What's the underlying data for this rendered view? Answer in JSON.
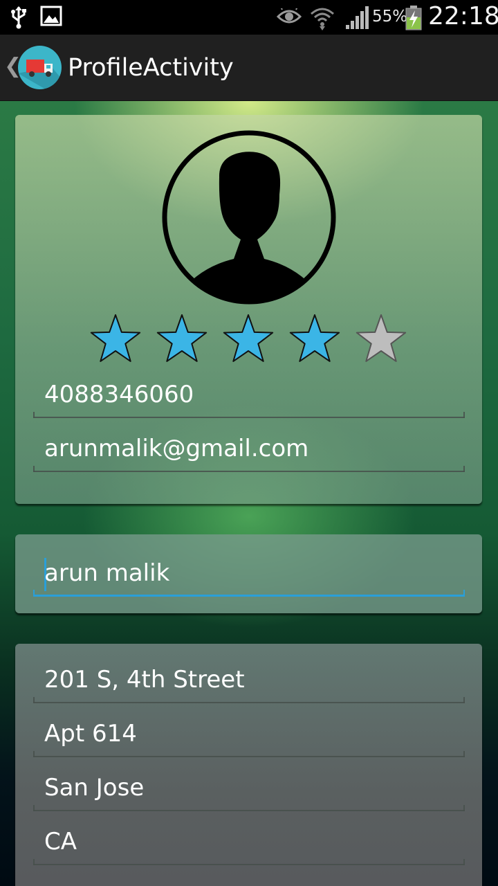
{
  "status_bar": {
    "battery_percent": "55%",
    "clock": "22:18",
    "icons": [
      "usb-icon",
      "gallery-icon",
      "eye-icon",
      "wifi-icon",
      "signal-icon",
      "battery-charging-icon"
    ]
  },
  "action_bar": {
    "title": "ProfileActivity",
    "up_glyph": "❮",
    "logo_icon": "delivery-truck-icon"
  },
  "profile": {
    "avatar_icon": "person-silhouette-icon",
    "rating": {
      "value": 4,
      "max": 5
    },
    "phone": "4088346060",
    "email": "arunmalik@gmail.com"
  },
  "name_card": {
    "name": "arun malik"
  },
  "address": {
    "line1": "201 S, 4th Street",
    "line2": "Apt 614",
    "city": "San Jose",
    "state": "CA"
  },
  "colors": {
    "star_filled": "#3bb5e6",
    "star_empty": "#bdbdbd",
    "focus_accent": "#2a9fd8"
  }
}
